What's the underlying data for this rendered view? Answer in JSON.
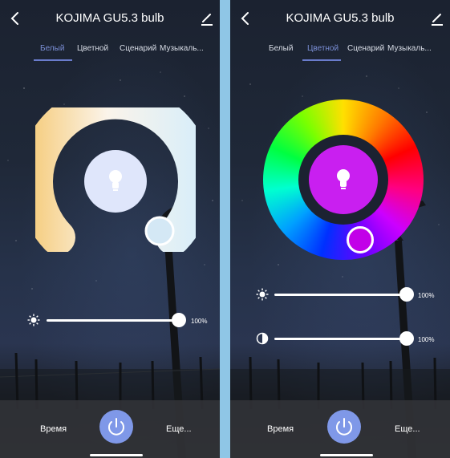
{
  "left": {
    "title": "KOJIMA GU5.3 bulb",
    "tabs": [
      "Белый",
      "Цветной",
      "Сценарий",
      "Музыкаль..."
    ],
    "active_tab": 0,
    "brightness": {
      "value": 100,
      "label": "100%"
    },
    "bottom": {
      "time_label": "Время",
      "more_label": "Еще..."
    },
    "wheel": {
      "type": "white-temperature",
      "center_color": "#dfe6fb",
      "accent": "#7b8fd6"
    }
  },
  "right": {
    "title": "KOJIMA GU5.3 bulb",
    "tabs": [
      "Белый",
      "Цветной",
      "Сценарий",
      "Музыкаль..."
    ],
    "active_tab": 1,
    "brightness": {
      "value": 100,
      "label": "100%"
    },
    "saturation": {
      "value": 100,
      "label": "100%"
    },
    "bottom": {
      "time_label": "Время",
      "more_label": "Еще..."
    },
    "wheel": {
      "type": "color-hue",
      "center_color": "#c91ff0",
      "accent": "#7b8fd6"
    }
  },
  "icons": {
    "back": "chevron-left-icon",
    "edit": "pencil-icon",
    "bulb": "bulb-icon",
    "brightness": "sun-icon",
    "saturation": "contrast-icon",
    "power": "power-icon"
  }
}
